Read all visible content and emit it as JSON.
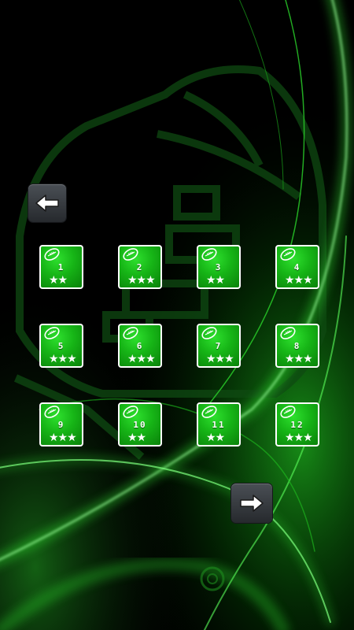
{
  "screen": "level-select",
  "colors": {
    "accent": "#1fc41f",
    "background": "#000000",
    "tile_border": "#ffffff"
  },
  "navigation": {
    "back_icon": "arrow-left-icon",
    "next_icon": "arrow-right-icon"
  },
  "levels": [
    {
      "number": "1",
      "stars": 2,
      "stars_text": "★★"
    },
    {
      "number": "2",
      "stars": 3,
      "stars_text": "★★★"
    },
    {
      "number": "3",
      "stars": 2,
      "stars_text": "★★"
    },
    {
      "number": "4",
      "stars": 3,
      "stars_text": "★★★"
    },
    {
      "number": "5",
      "stars": 3,
      "stars_text": "★★★"
    },
    {
      "number": "6",
      "stars": 3,
      "stars_text": "★★★"
    },
    {
      "number": "7",
      "stars": 3,
      "stars_text": "★★★"
    },
    {
      "number": "8",
      "stars": 3,
      "stars_text": "★★★"
    },
    {
      "number": "9",
      "stars": 3,
      "stars_text": "★★★"
    },
    {
      "number": "10",
      "stars": 2,
      "stars_text": "★★"
    },
    {
      "number": "11",
      "stars": 2,
      "stars_text": "★★"
    },
    {
      "number": "12",
      "stars": 3,
      "stars_text": "★★★"
    }
  ]
}
